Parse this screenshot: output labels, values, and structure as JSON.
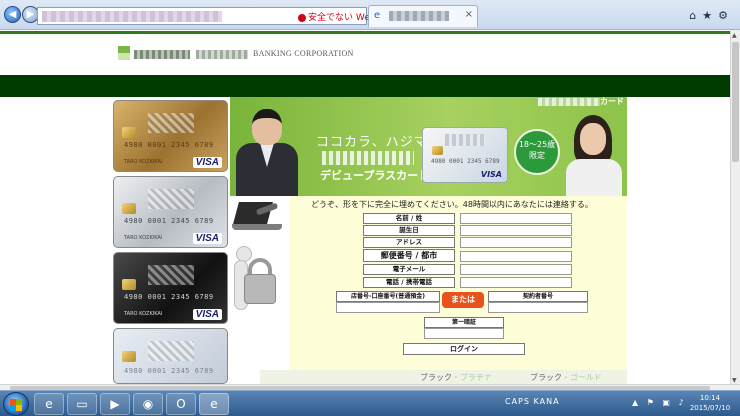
{
  "browser": {
    "address_url": "",
    "security_warning": "安全でない Web サイト",
    "tab_title": "",
    "tab_close": "×",
    "back_glyph": "◀",
    "forward_glyph": "▶",
    "toolbar_icons": [
      "home-icon",
      "favorites-star-icon",
      "tools-gear-icon"
    ],
    "toolbar_glyphs": "⌂★⚙"
  },
  "site": {
    "logo_text": "BANKING CORPORATION",
    "banner_corner_text": "カード",
    "banner_headline": "ココカラ、ハジマル。",
    "banner_card_name": "デビュープラスカード",
    "age_badge_line1": "18～25歳",
    "age_badge_line2": "限定",
    "banner_card_number": "4980 0001 2345 6789",
    "banner_card_visa": "VISA"
  },
  "cards": [
    {
      "tier": "gold",
      "number": "4980 0001 2345 6789",
      "holder": "TARO KOZKIKAI",
      "brand": "VISA"
    },
    {
      "tier": "silver",
      "number": "4980 0001 2345 6789",
      "holder": "TARO KOZKIKAI",
      "brand": "VISA"
    },
    {
      "tier": "black",
      "number": "4980 0001 2345 6789",
      "holder": "TARO KOZKIKAI",
      "brand": "VISA"
    },
    {
      "tier": "pale",
      "number": "4980 0001 2345 6789",
      "holder": "",
      "brand": ""
    }
  ],
  "form": {
    "intro": "どうぞ、形を下に完全に埋めてください。48時間以内にあなたには連絡する。",
    "rows": [
      {
        "label": "名前 / 姓",
        "value": ""
      },
      {
        "label": "誕生日",
        "value": ""
      },
      {
        "label": "アドレス",
        "value": ""
      },
      {
        "label": "郵便番号 / 都市",
        "value": ""
      },
      {
        "label": "電子メール",
        "value": ""
      },
      {
        "label": "電話 / 携帯電話",
        "value": ""
      }
    ],
    "account_label": "店番号-口座番号(普通預金)",
    "or_label": "または",
    "contract_label": "契約者番号",
    "pin_label": "第一暗証",
    "login_label": "ログイン"
  },
  "bottom_strip": {
    "left_text_main": "ブラック",
    "left_text_accent": "・プラチナ",
    "right_text_main": "ブラック",
    "right_text_accent": "・ゴールド"
  },
  "taskbar": {
    "apps": [
      "ie-icon",
      "explorer-icon",
      "media-player-icon",
      "chrome-icon",
      "outlook-icon",
      "ie-pinned-icon"
    ],
    "app_glyphs": [
      "e",
      "▭",
      "▶",
      "◉",
      "O",
      "e"
    ],
    "tray_text": "CAPS KANA",
    "tray_icons": "▲ ⚑ ▣ ♪",
    "clock_time": "10:14",
    "clock_date": "2015/07/10"
  }
}
